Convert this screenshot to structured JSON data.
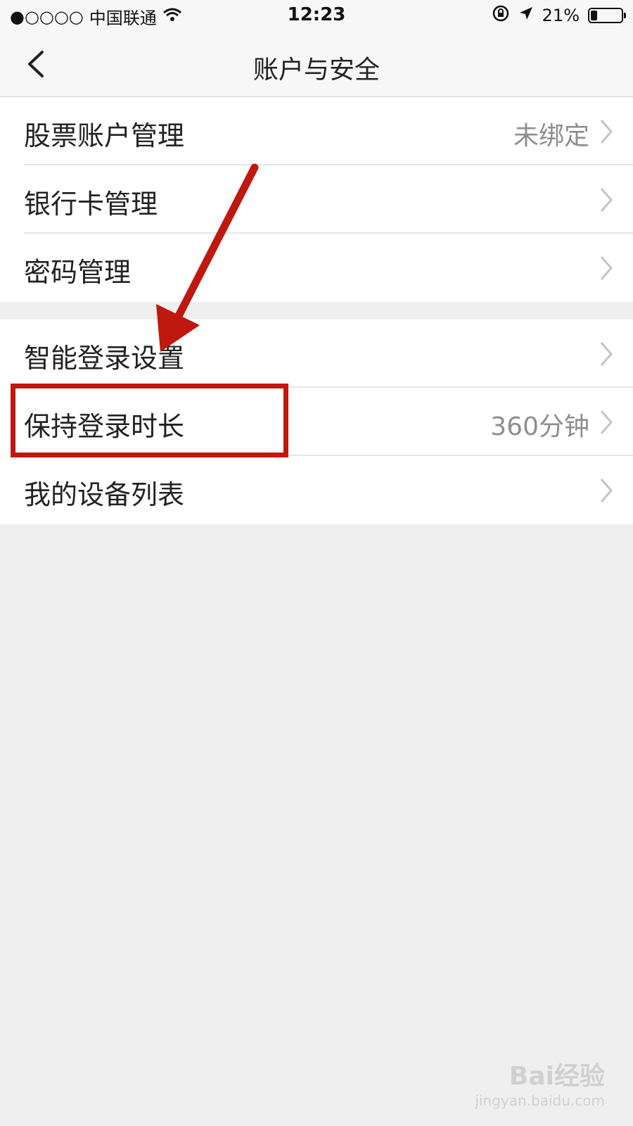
{
  "status_bar": {
    "signal": "●○○○○",
    "carrier": "中国联通",
    "time": "12:23",
    "battery": "21%",
    "battery_level": 0.21
  },
  "nav": {
    "title": "账户与安全"
  },
  "group1": [
    {
      "label": "股票账户管理",
      "value": "未绑定"
    },
    {
      "label": "银行卡管理",
      "value": ""
    },
    {
      "label": "密码管理",
      "value": ""
    }
  ],
  "group2": [
    {
      "label": "智能登录设置",
      "value": ""
    },
    {
      "label": "保持登录时长",
      "value": "360分钟"
    },
    {
      "label": "我的设备列表",
      "value": ""
    }
  ],
  "annotation": {
    "color": "#c0170f"
  },
  "watermark": {
    "brand": "Bai经验",
    "url": "jingyan.baidu.com"
  }
}
